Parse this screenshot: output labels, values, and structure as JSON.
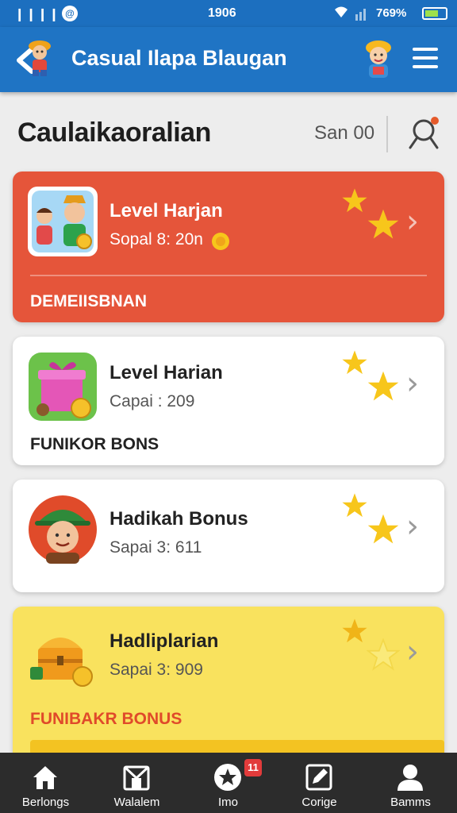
{
  "status_bar": {
    "signal": "❙❙❙❙",
    "time": "1906",
    "battery": "769%"
  },
  "app_bar": {
    "title": "Casual Ilapa Blaugan"
  },
  "header": {
    "title": "Caulaikaoralian",
    "value": "San 00"
  },
  "cards": [
    {
      "title": "Level Harjan",
      "subtitle": "Sopal 8: 20n",
      "footer": "DEMEIISBNAN",
      "bg_color": "#e5553a"
    },
    {
      "title": "Level Harian",
      "subtitle": "Capai : 209",
      "footer": "FUNIKOR BONS",
      "bg_color": "#ffffff"
    },
    {
      "title": "Hadikah Bonus",
      "subtitle": "Sapai 3: 611",
      "footer": "",
      "bg_color": "#ffffff"
    },
    {
      "title": "Hadliplarian",
      "subtitle": "Sapai 3: 909",
      "footer": "FUNIBAKR BONUS",
      "bg_color": "#f9e25e"
    }
  ],
  "bottom_nav": {
    "items": [
      {
        "label": "Berlongs",
        "icon": "home-icon"
      },
      {
        "label": "Walalem",
        "icon": "map-icon"
      },
      {
        "label": "Imo",
        "icon": "star-badge-icon"
      },
      {
        "label": "Corige",
        "icon": "edit-icon"
      },
      {
        "label": "Bamms",
        "icon": "profile-icon"
      }
    ],
    "badge": "11"
  },
  "colors": {
    "app_bar": "#1f74c4",
    "accent_star": "#f7c61b",
    "bottom_nav": "#2c2c2c"
  }
}
